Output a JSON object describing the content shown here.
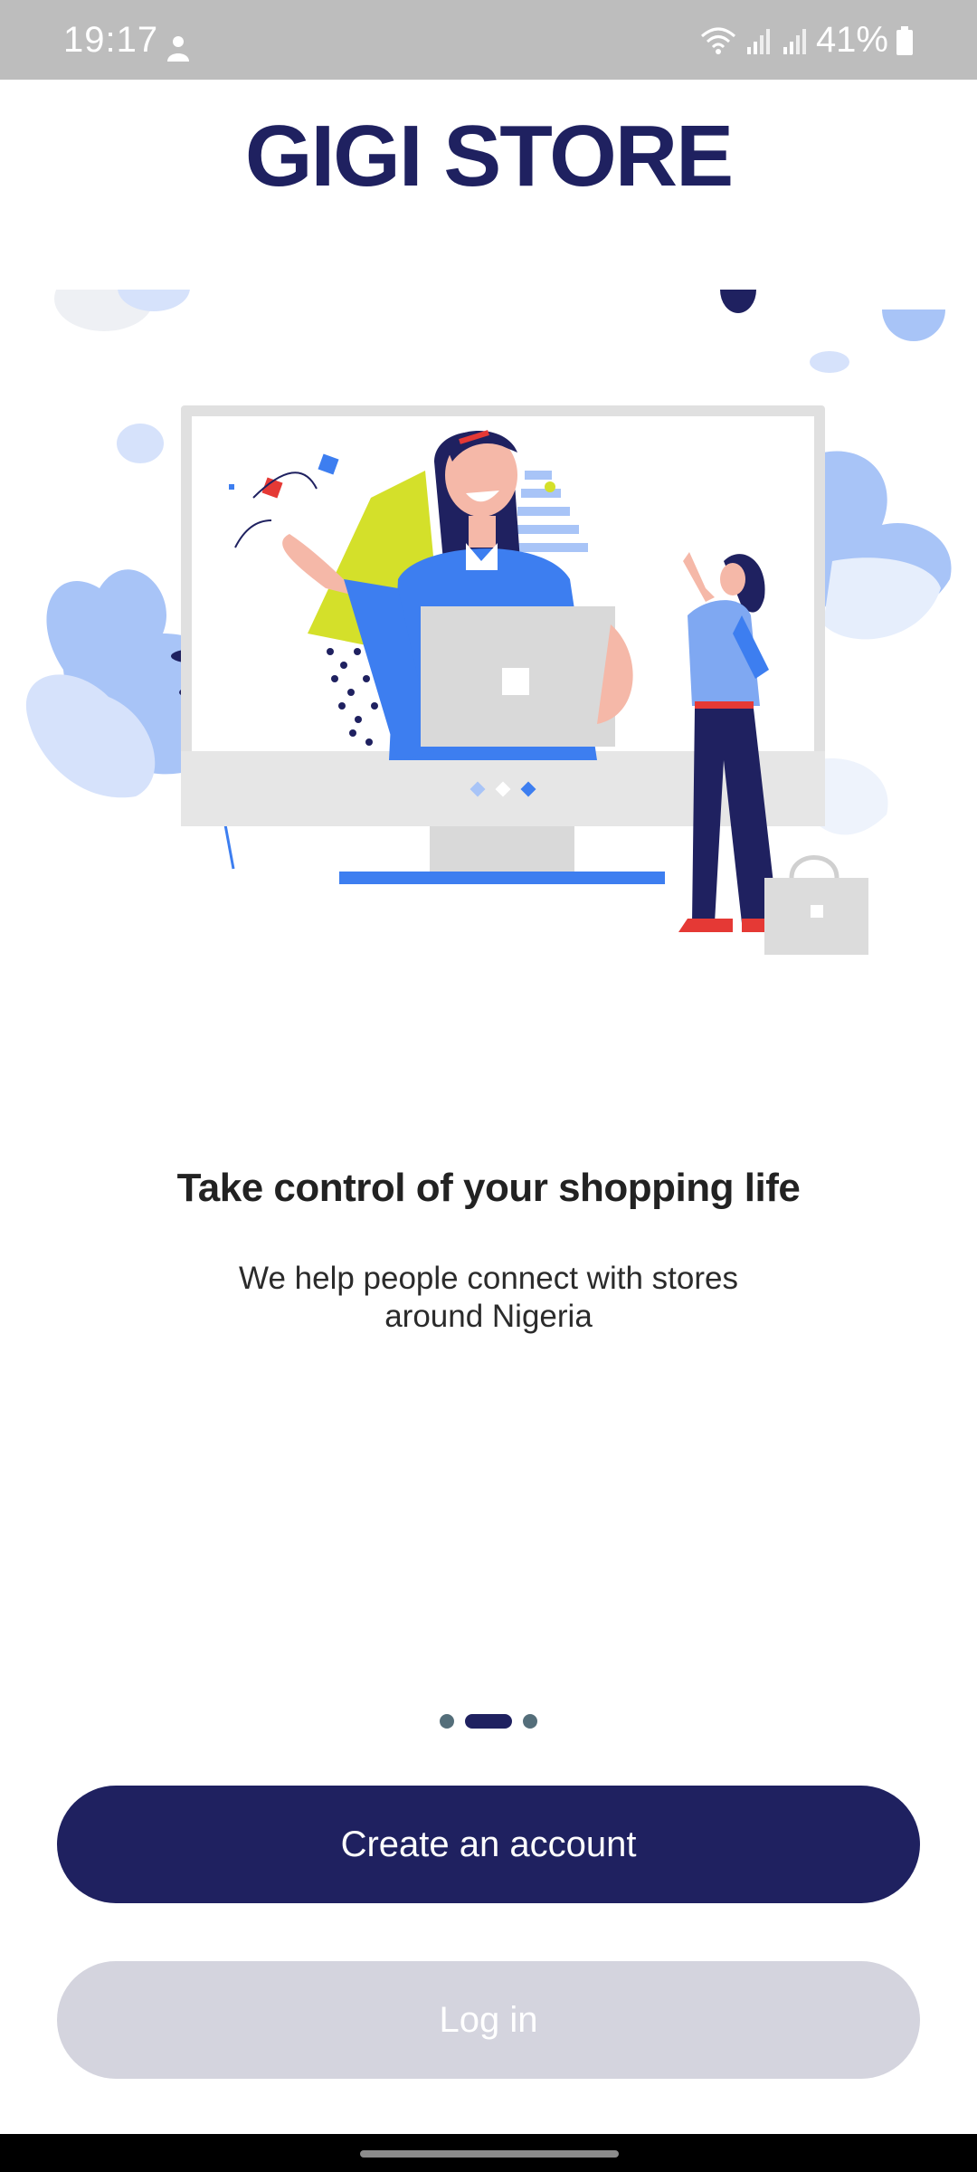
{
  "status_bar": {
    "time": "19:17",
    "battery": "41%",
    "icons": [
      "person-icon",
      "wifi-icon",
      "signal-icon",
      "signal-icon",
      "battery-icon"
    ]
  },
  "brand": {
    "title": "GIGI STORE",
    "color": "#1f2160"
  },
  "onboarding": {
    "headline": "Take control of your shopping life",
    "subtext": "We help people connect with stores around Nigeria",
    "page_count": 3,
    "active_page": 2
  },
  "actions": {
    "create_account_label": "Create an account",
    "login_label": "Log in"
  },
  "colors": {
    "primary": "#1f2160",
    "secondary_button": "#d4d4de",
    "accent_blue": "#3d7ef0",
    "light_blue": "#a8c4f7"
  }
}
